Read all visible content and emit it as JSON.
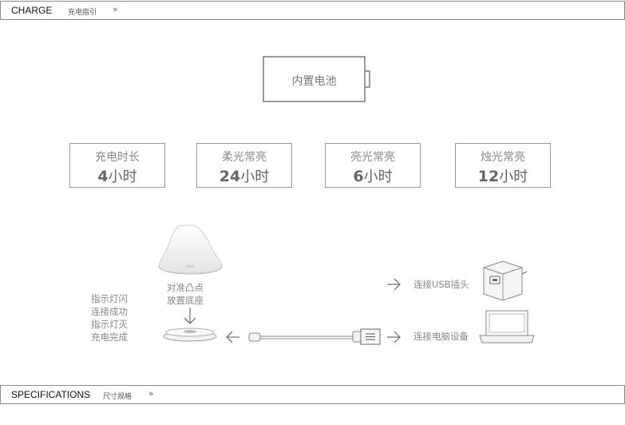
{
  "header": {
    "title": "CHARGE",
    "subtitle": "充电指引",
    "chevron": "»"
  },
  "battery": {
    "label": "内置电池"
  },
  "specs": [
    {
      "label": "充电时长",
      "value_num": "4",
      "value_unit": "小时"
    },
    {
      "label": "柔光常亮",
      "value_num": "24",
      "value_unit": "小时"
    },
    {
      "label": "亮光常亮",
      "value_num": "6",
      "value_unit": "小时"
    },
    {
      "label": "烛光常亮",
      "value_num": "12",
      "value_unit": "小时"
    }
  ],
  "diagram": {
    "align_text_1": "对准凸点",
    "align_text_2": "放置底座",
    "indicator_lines": [
      "指示灯闪",
      "连接成功",
      "指示灯灭",
      "充电完成"
    ],
    "usb_label": "连接USB插头",
    "computer_label": "连接电脑设备"
  },
  "footer": {
    "title": "SPECIFICATIONS",
    "subtitle": "尺寸规格",
    "chevron": "»"
  }
}
